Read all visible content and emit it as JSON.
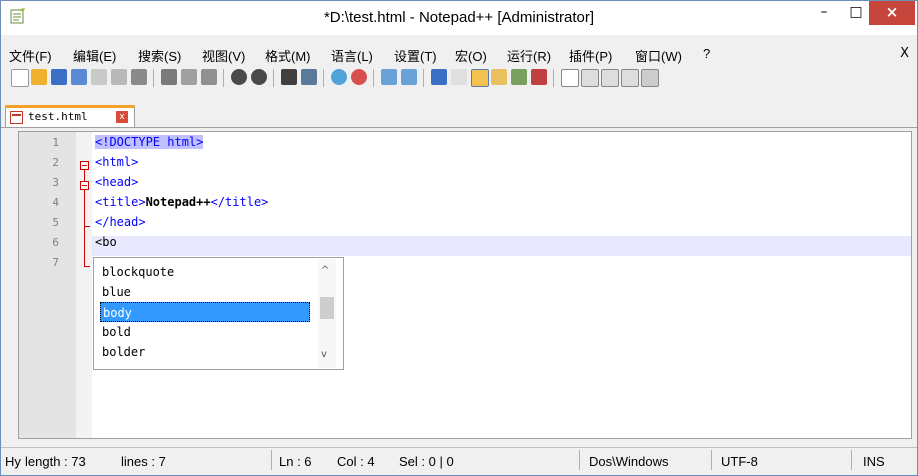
{
  "window": {
    "title": "*D:\\test.html - Notepad++ [Administrator]",
    "min_label": "–",
    "max_label": "□",
    "close_label": "×"
  },
  "menu": {
    "items": [
      "文件(F)",
      "编辑(E)",
      "搜索(S)",
      "视图(V)",
      "格式(M)",
      "语言(L)",
      "设置(T)",
      "宏(O)",
      "运行(R)",
      "插件(P)",
      "窗口(W)",
      "?"
    ],
    "close_label": "X"
  },
  "tab": {
    "label": "test.html",
    "close_label": "x"
  },
  "editor": {
    "line_numbers": [
      "1",
      "2",
      "3",
      "4",
      "5",
      "6",
      "7"
    ],
    "lines": {
      "l1": "<!DOCTYPE html>",
      "l2": "<html>",
      "l3": "<head>",
      "l4_open": "<title>",
      "l4_text": "Notepad++",
      "l4_close": "</title>",
      "l5": "</head>",
      "l6": "<bo"
    }
  },
  "autocomplete": {
    "items": [
      "blockquote",
      "blue",
      "body",
      "bold",
      "bolder"
    ],
    "selected_index": 2,
    "scroll_up": "^",
    "scroll_down": "v"
  },
  "status": {
    "type": "Hy",
    "length": "length : 73",
    "lines": "lines : 7",
    "ln": "Ln : 6",
    "col": "Col : 4",
    "sel": "Sel : 0 | 0",
    "eol": "Dos\\Windows",
    "encoding": "UTF-8",
    "mode": "INS"
  },
  "colors": {
    "tag": "#0000ff",
    "selection": "#3399ff",
    "close_button": "#c7463c",
    "current_line": "#e8e8ff"
  }
}
